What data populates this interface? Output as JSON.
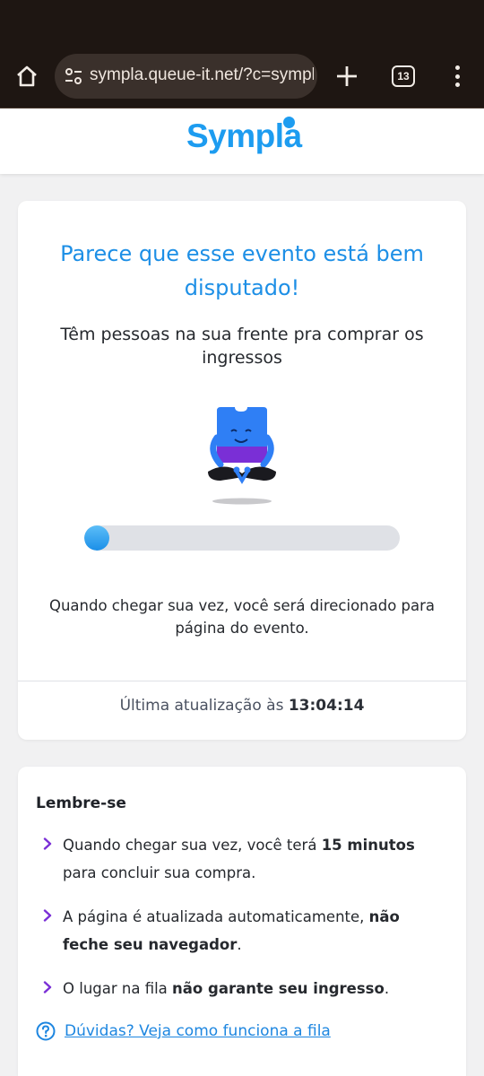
{
  "browser": {
    "url": "sympla.queue-it.net/?c=sympla",
    "tab_count": "13"
  },
  "header": {
    "logo": "Sympla"
  },
  "queue": {
    "title": "Parece que esse evento está bem disputado!",
    "subtitle": "Têm pessoas na sua frente pra comprar os ingressos",
    "progress_fraction": 0.07,
    "note": "Quando chegar sua vez, você será direcionado para página do evento.",
    "last_updated_label": "Última atualização às",
    "last_updated_time": "13:04:14"
  },
  "remember": {
    "heading": "Lembre-se",
    "tip1_a": "Quando chegar sua vez, você terá ",
    "tip1_b": "15 minutos",
    "tip1_c": " para concluir sua compra.",
    "tip2_a": "A página é atualizada automaticamente, ",
    "tip2_b": "não feche seu navegador",
    "tip2_c": ".",
    "tip3_a": "O lugar na fila ",
    "tip3_b": "não garante seu ingresso",
    "tip3_c": ".",
    "faq_link": "Dúvidas? Veja como funciona a fila"
  },
  "colors": {
    "brand_blue": "#1d9cf0",
    "accent_purple": "#7a2fd6",
    "chrome_bg": "#1e1612"
  },
  "icons": [
    "home-icon",
    "site-settings-icon",
    "new-tab-icon",
    "tab-switcher-icon",
    "more-menu-icon",
    "chevron-right-icon",
    "help-circle-icon"
  ]
}
